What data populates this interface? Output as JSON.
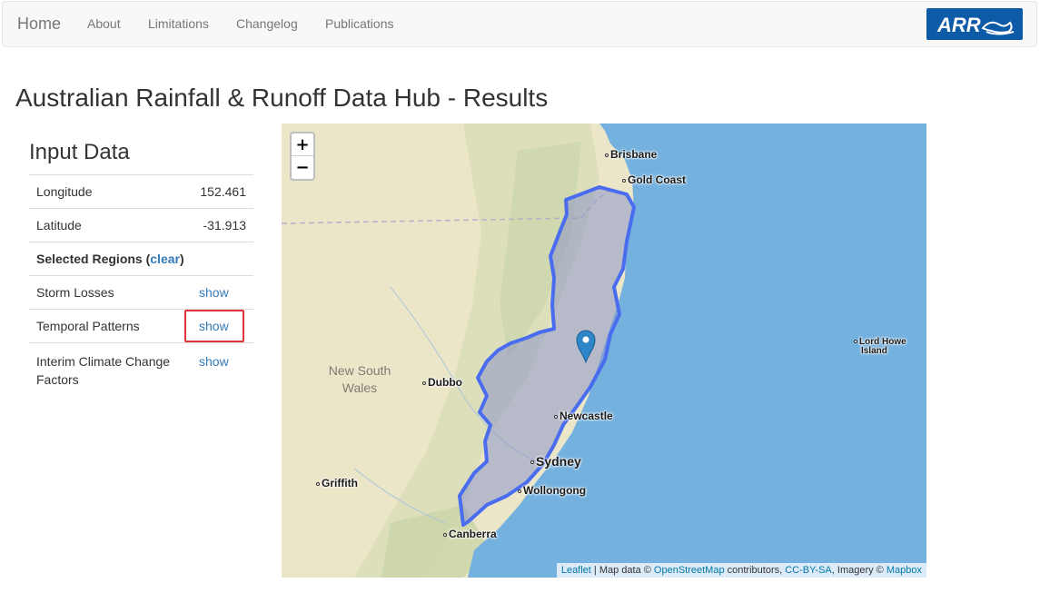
{
  "navbar": {
    "brand": "Home",
    "links": [
      "About",
      "Limitations",
      "Changelog",
      "Publications"
    ],
    "logo_text": "ARR",
    "logo_color": "#0d5aa7"
  },
  "page_title": "Australian Rainfall & Runoff Data Hub - Results",
  "input_data": {
    "heading": "Input Data",
    "longitude_label": "Longitude",
    "longitude_value": "152.461",
    "latitude_label": "Latitude",
    "latitude_value": "-31.913",
    "selected_regions_label": "Selected Regions (",
    "clear_label": "clear",
    "selected_regions_close": ")",
    "rows": [
      {
        "label": "Storm Losses",
        "action": "show"
      },
      {
        "label": "Temporal Patterns",
        "action": "show"
      },
      {
        "label": "Interim Climate Change Factors",
        "action": "show"
      }
    ],
    "highlight_color": "#e0363b"
  },
  "map": {
    "zoom_in": "+",
    "zoom_out": "−",
    "cities": {
      "brisbane": "Brisbane",
      "gold_coast": "Gold Coast",
      "dubbo": "Dubbo",
      "newcastle": "Newcastle",
      "sydney": "Sydney",
      "wollongong": "Wollongong",
      "griffith": "Griffith",
      "canberra": "Canberra",
      "lord_howe_1": "Lord Howe",
      "lord_howe_2": "Island"
    },
    "state_label_1": "New South",
    "state_label_2": "Wales",
    "attribution": {
      "leaflet": "Leaflet",
      "sep": " | Map data © ",
      "osm": "OpenStreetMap",
      "contrib": " contributors, ",
      "license": "CC-BY-SA",
      "imagery": ", Imagery © ",
      "mapbox": "Mapbox"
    },
    "colors": {
      "land": "#ece6c9",
      "ocean": "#75b1df",
      "region_fill": "#8c96c8",
      "region_stroke": "#4a6df0",
      "marker": "#2e86c9"
    }
  }
}
